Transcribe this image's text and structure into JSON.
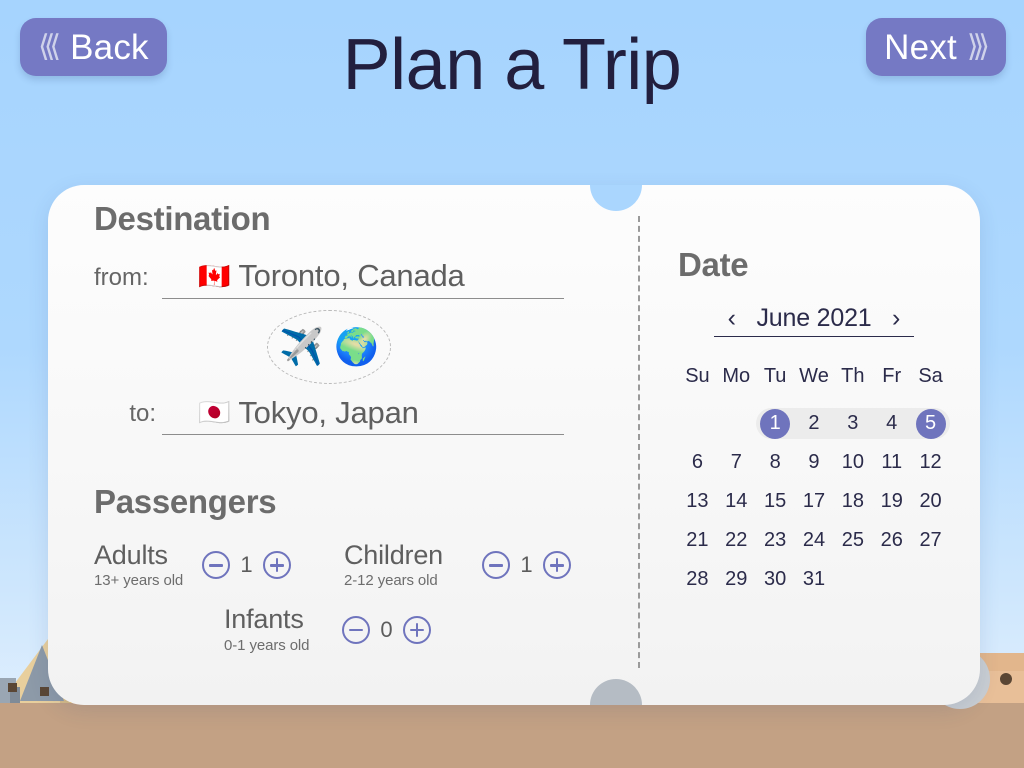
{
  "header": {
    "title": "Plan a Trip",
    "back_label": "Back",
    "next_label": "Next",
    "back_chevrons": "⟨⟨⟨",
    "next_chevrons": "⟩⟩⟩",
    "button_color": "#7579c4",
    "title_color": "#221f3e"
  },
  "background": {
    "sky_top": "#a6d4fe",
    "sky_bottom": "#e7f2fe",
    "ground_color": "#c3a184"
  },
  "destination": {
    "title": "Destination",
    "from": {
      "label": "from:",
      "flag": "🇨🇦",
      "city": "Toronto, Canada"
    },
    "to": {
      "label": "to:",
      "flag": "🇯🇵",
      "city": "Tokyo, Japan"
    },
    "swap": {
      "plane_icon": "✈️",
      "globe_icon": "🌍"
    }
  },
  "passengers": {
    "title": "Passengers",
    "decrement_label": "−",
    "increment_label": "+",
    "groups": [
      {
        "name": "Adults",
        "age": "13+ years old",
        "count": "1"
      },
      {
        "name": "Children",
        "age": "2-12 years old",
        "count": "1"
      },
      {
        "name": "Infants",
        "age": "0-1 years old",
        "count": "0"
      }
    ]
  },
  "date": {
    "title": "Date",
    "month_label": "June 2021",
    "prev_label": "‹",
    "next_label": "›",
    "weekdays": [
      "Su",
      "Mo",
      "Tu",
      "We",
      "Th",
      "Fr",
      "Sa"
    ],
    "accent_color": "#6f74bd",
    "range_color": "#ececec",
    "weeks": [
      [
        "",
        "",
        "1",
        "2",
        "3",
        "4",
        "5"
      ],
      [
        "6",
        "7",
        "8",
        "9",
        "10",
        "11",
        "12"
      ],
      [
        "13",
        "14",
        "15",
        "17",
        "18",
        "19",
        "20"
      ],
      [
        "21",
        "22",
        "23",
        "24",
        "25",
        "26",
        "27"
      ],
      [
        "28",
        "29",
        "30",
        "31",
        "",
        "",
        ""
      ]
    ],
    "selected": [
      "1",
      "5"
    ],
    "range_row": 0,
    "range_start_col": 2,
    "range_end_col": 6
  }
}
